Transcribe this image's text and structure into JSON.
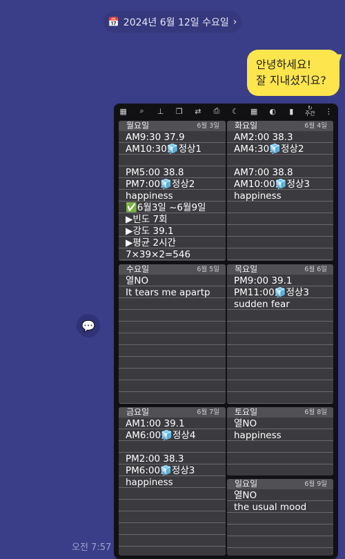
{
  "header": {
    "date_label": "2024년 6월 12일 수요일",
    "chevron": "›"
  },
  "message": {
    "line1": "안녕하세요!",
    "line2": "잘 지내셨지요?"
  },
  "time": "오전 7:57",
  "toolbar": {
    "icons": [
      "calendar-icon",
      "search-icon",
      "stamp-icon",
      "copy-icon",
      "repeat-icon",
      "print-icon",
      "moon-icon",
      "grid-icon",
      "palette-icon",
      "book-icon",
      "week-icon",
      "more-icon"
    ],
    "week_label": "주간"
  },
  "days": [
    {
      "name": "월요일",
      "date": "6월 3일",
      "lines": [
        "AM9:30  37.9",
        "AM10:30🧊정상1",
        "",
        "PM5:00  38.8",
        "PM7:00🧊정상2",
        "happiness",
        "✅6월3일 ~6월9일",
        "▶빈도 7회",
        "▶강도 39.1",
        "▶평균 2시간",
        "7×39×2=546"
      ]
    },
    {
      "name": "화요일",
      "date": "6월 4일",
      "lines": [
        "AM2:00  38.3",
        "AM4:30🧊정상2",
        "",
        "AM7:00  38.8",
        "AM10:00🧊정상3",
        "happiness"
      ]
    },
    {
      "name": "수요일",
      "date": "6월 5일",
      "lines": [
        "열NO",
        "It tears me apartp"
      ]
    },
    {
      "name": "목요일",
      "date": "6월 6일",
      "lines": [
        "PM9:00  39.1",
        "PM11:00🧊정상3",
        "sudden fear"
      ]
    },
    {
      "name": "금요일",
      "date": "6월 7일",
      "lines": [
        "AM1:00  39.1",
        "AM6:00🧊정상4",
        "",
        "PM2:00  38.3",
        "PM6:00🧊정상3",
        "happiness"
      ]
    },
    {
      "name": "토요일",
      "date": "6월 8일",
      "lines": [
        "열NO",
        "happiness"
      ]
    },
    {
      "name": "일요일",
      "date": "6월 9일",
      "lines": [
        "열NO",
        "the usual mood"
      ]
    }
  ]
}
